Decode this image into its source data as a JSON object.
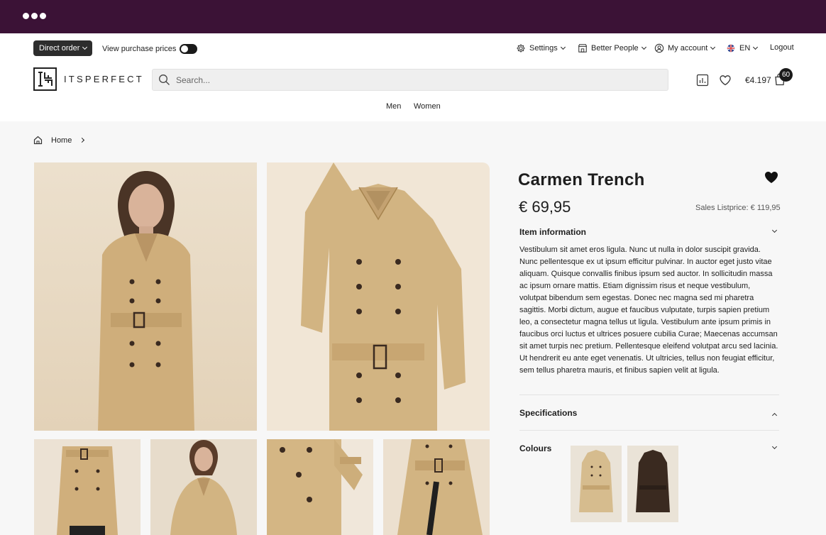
{
  "header": {
    "direct_order": "Direct order",
    "view_purchase_prices": "View purchase prices",
    "settings": "Settings",
    "company": "Better People",
    "account": "My account",
    "language": "EN",
    "logout": "Logout",
    "logo_text": "ITSPERFECT",
    "search_placeholder": "Search...",
    "cart_total": "€4.197",
    "cart_count": "60",
    "nav": [
      "Men",
      "Women"
    ]
  },
  "breadcrumb": {
    "home": "Home"
  },
  "product": {
    "title": "Carmen Trench",
    "price": "€ 69,95",
    "listprice": "Sales Listprice: € 119,95",
    "item_info_label": "Item information",
    "description": "Vestibulum sit amet eros ligula. Nunc ut nulla in dolor suscipit gravida. Nunc pellentesque ex ut ipsum efficitur pulvinar. In auctor eget justo vitae aliquam. Quisque convallis finibus ipsum sed auctor. In sollicitudin massa ac ipsum ornare mattis. Etiam dignissim risus et neque vestibulum, volutpat bibendum sem egestas. Donec nec magna sed mi pharetra sagittis. Morbi dictum, augue et faucibus vulputate, turpis sapien pretium leo, a consectetur magna tellus ut ligula. Vestibulum ante ipsum primis in faucibus orci luctus et ultrices posuere cubilia Curae; Maecenas accumsan sit amet turpis nec pretium. Pellentesque eleifend volutpat arcu sed lacinia. Ut hendrerit eu ante eget venenatis. Ut ultricies, tellus non feugiat efficitur, sem tellus pharetra mauris, et finibus sapien velit at ligula.",
    "specifications_label": "Specifications",
    "colours_label": "Colours",
    "colours": [
      "#d6bc8e",
      "#3a2a20"
    ]
  },
  "colors": {
    "chrome": "#3b1236",
    "accent_dark": "#1a1a1a"
  }
}
